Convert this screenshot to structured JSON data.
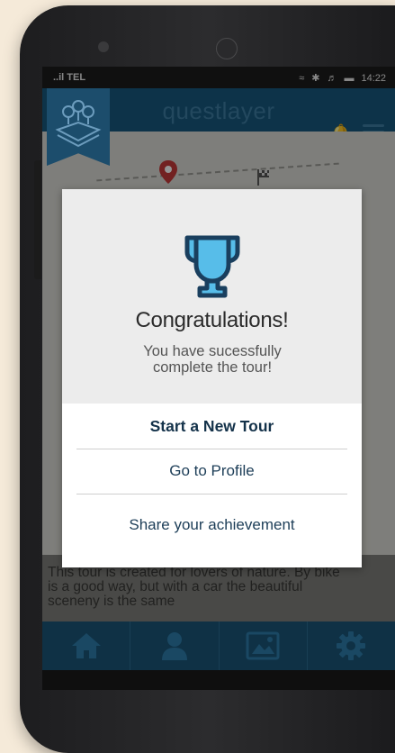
{
  "statusbar": {
    "carrier": "..il TEL",
    "time": "14:22"
  },
  "app": {
    "title": "questlayer"
  },
  "dialog": {
    "title": "Congratulations!",
    "message": "You have sucessfully complete the tour!",
    "actions": [
      {
        "label": "Start a New Tour"
      },
      {
        "label": "Go to Profile"
      },
      {
        "label": "Share your achievement"
      }
    ]
  },
  "tour": {
    "description": "This tour is created for lovers of nature. By bike is a good way, but with a car the beautiful sceneny is the same"
  },
  "tabbar": {
    "tabs": [
      {
        "icon": "home-icon"
      },
      {
        "icon": "user-icon"
      },
      {
        "icon": "image-icon"
      },
      {
        "icon": "gear-icon"
      }
    ]
  },
  "colors": {
    "header": "#17597f",
    "tabbar": "#1a5577",
    "trophy": "#57bde9",
    "primary_text": "#14324a"
  }
}
